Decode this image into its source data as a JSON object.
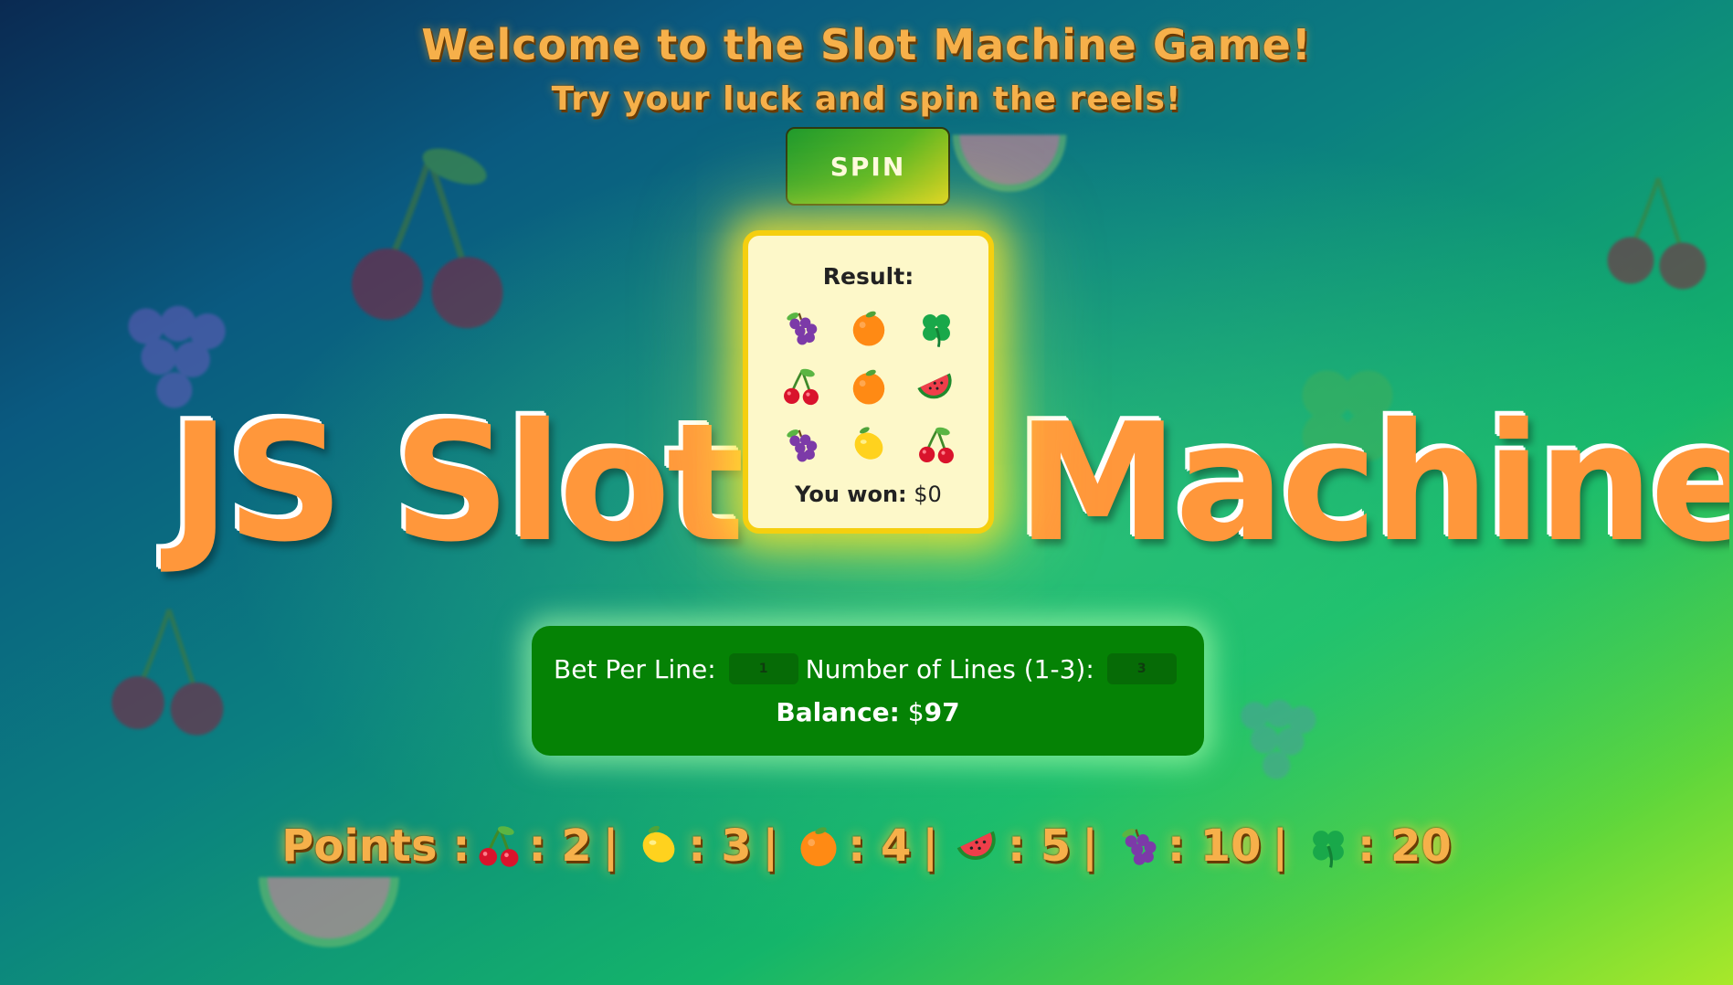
{
  "header": {
    "title": "Welcome to the Slot Machine Game!",
    "subtitle": "Try your luck and spin the reels!"
  },
  "spin_button": {
    "label": "SPIN"
  },
  "brand": {
    "left": "JS Slot",
    "right": "Machine"
  },
  "result": {
    "label": "Result:",
    "grid": [
      [
        "grape-icon",
        "orange-icon",
        "clover-icon"
      ],
      [
        "cherry-icon",
        "orange-icon",
        "watermelon-icon"
      ],
      [
        "grape-icon",
        "lemon-icon",
        "cherry-icon"
      ]
    ],
    "won_label": "You won:",
    "won_value": "$0"
  },
  "controls": {
    "bet_label": "Bet Per Line:",
    "bet_value": "1",
    "lines_label": "Number of Lines (1-3):",
    "lines_value": "3",
    "balance_label": "Balance:",
    "balance_currency": "$",
    "balance_value": "97"
  },
  "points": {
    "label": "Points :",
    "entries": [
      {
        "icon": "cherry-icon",
        "text": ": 2"
      },
      {
        "icon": "lemon-icon",
        "text": ": 3"
      },
      {
        "icon": "orange-icon",
        "text": ": 4"
      },
      {
        "icon": "watermelon-icon",
        "text": ": 5"
      },
      {
        "icon": "grape-icon",
        "text": ": 10"
      },
      {
        "icon": "clover-icon",
        "text": ": 20"
      }
    ],
    "separator": "|"
  },
  "colors": {
    "title": "#f6b04a",
    "brand": "#ff973b",
    "card_border": "#f5cf0f",
    "card_bg": "#fdf8c9",
    "controls_bg": "#058205"
  }
}
